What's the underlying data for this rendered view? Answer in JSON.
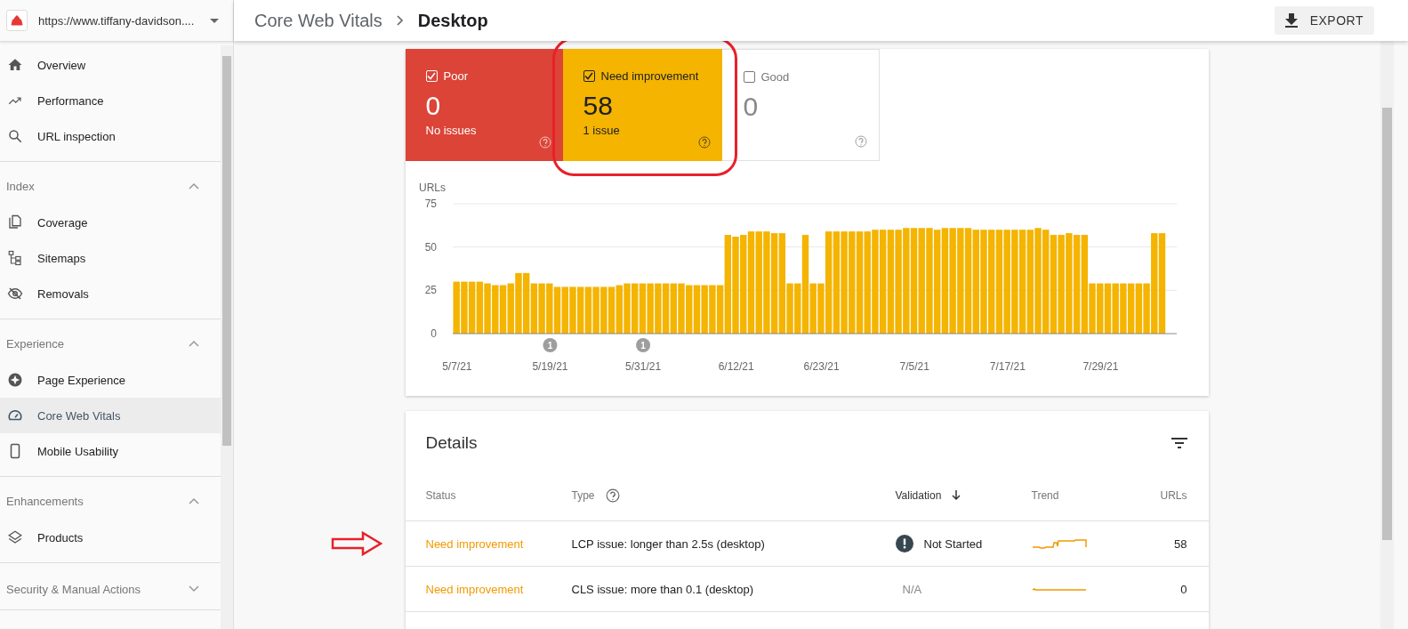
{
  "property": {
    "url": "https://www.tiffany-davidson...."
  },
  "sidebar": {
    "items": [
      {
        "label": "Overview",
        "selected": false
      },
      {
        "label": "Performance",
        "selected": false
      },
      {
        "label": "URL inspection",
        "selected": false
      }
    ],
    "sections": [
      {
        "title": "Index",
        "expanded": true,
        "items": [
          {
            "label": "Coverage",
            "selected": false
          },
          {
            "label": "Sitemaps",
            "selected": false
          },
          {
            "label": "Removals",
            "selected": false
          }
        ]
      },
      {
        "title": "Experience",
        "expanded": true,
        "items": [
          {
            "label": "Page Experience",
            "selected": false
          },
          {
            "label": "Core Web Vitals",
            "selected": true
          },
          {
            "label": "Mobile Usability",
            "selected": false
          }
        ]
      },
      {
        "title": "Enhancements",
        "expanded": true,
        "items": [
          {
            "label": "Products",
            "selected": false
          }
        ]
      },
      {
        "title": "Security & Manual Actions",
        "expanded": false
      }
    ]
  },
  "header": {
    "breadcrumb": "Core Web Vitals",
    "title": "Desktop",
    "export": "EXPORT"
  },
  "tiles": [
    {
      "kind": "poor",
      "label": "Poor",
      "checked": true,
      "count": "0",
      "subtitle": "No issues"
    },
    {
      "kind": "need",
      "label": "Need improvement",
      "checked": true,
      "count": "58",
      "subtitle": "1 issue"
    },
    {
      "kind": "good",
      "label": "Good",
      "checked": false,
      "count": "0"
    }
  ],
  "chart": {
    "chart_data": {
      "type": "bar",
      "ylabel": "URLs",
      "ylim": [
        0,
        75
      ],
      "yticks": [
        0,
        25,
        50,
        75
      ],
      "categories": [
        "5/7/21",
        null,
        null,
        null,
        null,
        null,
        null,
        null,
        null,
        null,
        null,
        null,
        "5/19/21",
        null,
        null,
        null,
        null,
        null,
        null,
        null,
        null,
        null,
        null,
        null,
        "5/31/21",
        null,
        null,
        null,
        null,
        null,
        null,
        null,
        null,
        null,
        null,
        null,
        "6/12/21",
        null,
        null,
        null,
        null,
        null,
        null,
        null,
        null,
        null,
        null,
        "6/23/21",
        null,
        null,
        null,
        null,
        null,
        null,
        null,
        null,
        null,
        null,
        null,
        "7/5/21",
        null,
        null,
        null,
        null,
        null,
        null,
        null,
        null,
        null,
        null,
        null,
        "7/17/21",
        null,
        null,
        null,
        null,
        null,
        null,
        null,
        null,
        null,
        null,
        null,
        "7/29/21",
        null,
        null,
        null,
        null,
        null,
        null,
        null,
        null
      ],
      "series": [
        {
          "color": "#f4b400",
          "values": [
            30,
            30,
            30,
            30,
            29,
            28,
            28,
            29,
            35,
            35,
            29,
            29,
            29,
            27,
            27,
            27,
            27,
            27,
            27,
            27,
            27,
            28,
            29,
            29,
            29,
            29,
            29,
            29,
            29,
            29,
            28,
            28,
            28,
            28,
            28,
            57,
            56,
            57,
            59,
            59,
            59,
            58,
            58,
            29,
            29,
            57,
            29,
            29,
            59,
            59,
            59,
            59,
            59,
            59,
            60,
            60,
            60,
            60,
            61,
            61,
            61,
            61,
            60,
            61,
            61,
            61,
            61,
            60,
            60,
            60,
            60,
            60,
            60,
            60,
            60,
            61,
            60,
            57,
            57,
            58,
            57,
            57,
            29,
            29,
            29,
            29,
            29,
            29,
            29,
            29,
            58,
            58
          ]
        }
      ],
      "annotations": [
        "1",
        "1"
      ]
    }
  },
  "details": {
    "title": "Details",
    "columns": [
      {
        "label": "Status",
        "sorted": false,
        "help": false
      },
      {
        "label": "Type",
        "sorted": false,
        "help": true
      },
      {
        "label": "Validation",
        "sorted": true,
        "help": false
      },
      {
        "label": "Trend",
        "sorted": false,
        "help": false
      },
      {
        "label": "URLs",
        "sorted": false,
        "help": false
      }
    ],
    "rows": [
      {
        "status": "Need improvement",
        "type": "LCP issue: longer than 2.5s (desktop)",
        "validation": "Not Started",
        "kind": "not_started",
        "urls": "58"
      },
      {
        "status": "Need improvement",
        "type": "CLS issue: more than 0.1 (desktop)",
        "validation": "N/A",
        "kind": "na",
        "urls": "0"
      }
    ]
  }
}
